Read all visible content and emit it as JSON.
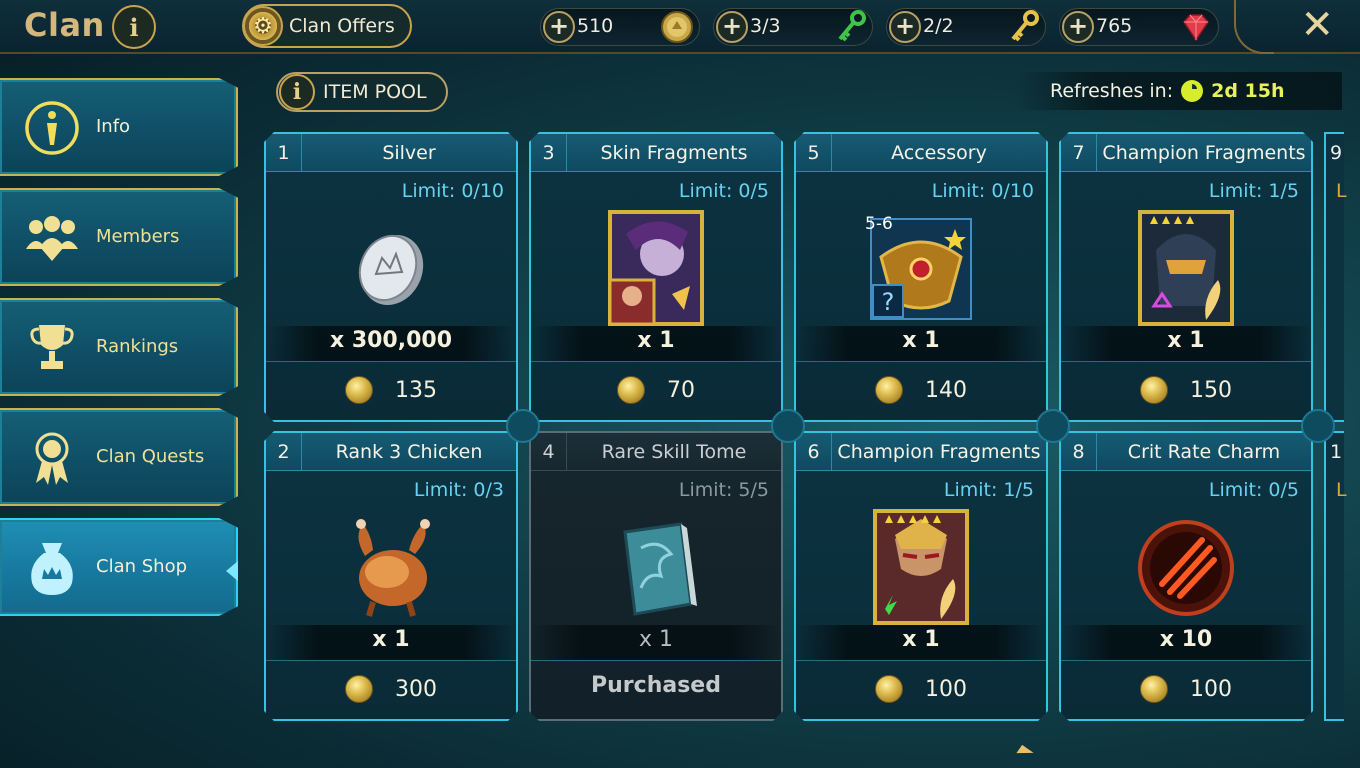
{
  "header": {
    "title": "Clan",
    "clan_offers_label": "Clan Offers",
    "close_icon": "close-icon"
  },
  "resources": [
    {
      "name": "silver",
      "value": "510",
      "icon": "silver-coin-icon"
    },
    {
      "name": "clan-key-green",
      "value": "3/3",
      "icon": "green-key-icon"
    },
    {
      "name": "clan-key-gold",
      "value": "2/2",
      "icon": "gold-key-icon"
    },
    {
      "name": "gems",
      "value": "765",
      "icon": "ruby-gem-icon"
    }
  ],
  "sidebar": {
    "items": [
      {
        "label": "Info",
        "icon": "info-icon",
        "active": false
      },
      {
        "label": "Members",
        "icon": "members-icon",
        "active": false
      },
      {
        "label": "Rankings",
        "icon": "trophy-icon",
        "active": false
      },
      {
        "label": "Clan Quests",
        "icon": "medal-icon",
        "active": false
      },
      {
        "label": "Clan Shop",
        "icon": "shop-bag-icon",
        "active": true
      }
    ]
  },
  "item_pool": {
    "label": "ITEM POOL"
  },
  "refresh": {
    "label": "Refreshes in:",
    "value": "2d 15h"
  },
  "cards": [
    {
      "num": "1",
      "name": "Silver",
      "limit": "Limit: 0/10",
      "qty": "x 300,000",
      "price": "135",
      "purchased": false,
      "icon": "silver-coin-icon"
    },
    {
      "num": "3",
      "name": "Skin Fragments",
      "limit": "Limit: 0/5",
      "qty": "x 1",
      "price": "70",
      "purchased": false,
      "icon": "skin-portrait-icon"
    },
    {
      "num": "5",
      "name": "Accessory",
      "limit": "Limit: 0/10",
      "qty": "x 1",
      "price": "140",
      "purchased": false,
      "icon": "accessory-icon",
      "rank": "5-6"
    },
    {
      "num": "7",
      "name": "Champion Fragments",
      "limit": "Limit: 1/5",
      "qty": "x 1",
      "price": "150",
      "purchased": false,
      "icon": "champion-portrait-icon"
    },
    {
      "num": "2",
      "name": "Rank 3 Chicken",
      "limit": "Limit: 0/3",
      "qty": "x 1",
      "price": "300",
      "purchased": false,
      "icon": "chicken-icon"
    },
    {
      "num": "4",
      "name": "Rare Skill Tome",
      "limit": "Limit: 5/5",
      "qty": "x 1",
      "price": "",
      "purchased": true,
      "purchased_label": "Purchased",
      "icon": "skill-tome-icon"
    },
    {
      "num": "6",
      "name": "Champion Fragments",
      "limit": "Limit: 1/5",
      "qty": "x 1",
      "price": "100",
      "purchased": false,
      "icon": "champion-portrait-icon"
    },
    {
      "num": "8",
      "name": "Crit Rate Charm",
      "limit": "Limit: 0/5",
      "qty": "x 10",
      "price": "100",
      "purchased": false,
      "icon": "crit-charm-icon"
    }
  ],
  "partial_column": [
    {
      "num": "9",
      "limit": "L"
    },
    {
      "num": "1",
      "limit": "L"
    }
  ],
  "colors": {
    "accent_cyan": "#34c4e2",
    "gold": "#c9a44e",
    "limit_text": "#67d2f2"
  }
}
